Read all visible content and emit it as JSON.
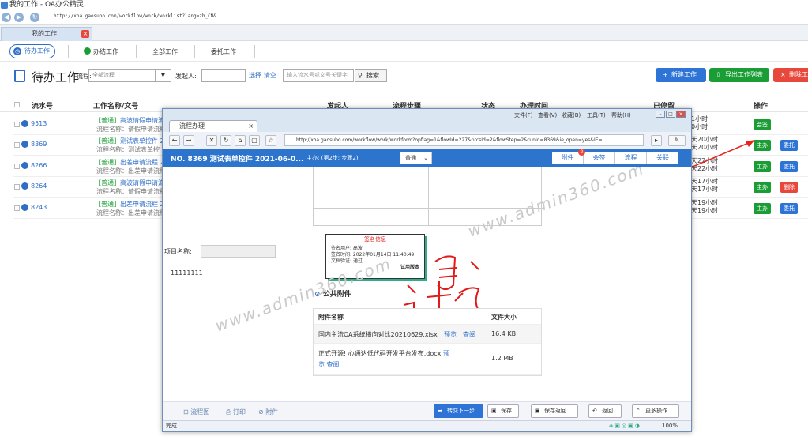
{
  "window": {
    "title": "我的工作 - OA办公精灵",
    "url": "http://xoa.gaosubo.com/workflow/work/worklist?lang=zh_CN&"
  },
  "tabs": [
    {
      "label": "我的工作"
    }
  ],
  "subnav": {
    "items": [
      "待办工作",
      "办结工作",
      "全部工作",
      "委托工作"
    ]
  },
  "toolbar": {
    "title": "待办工作",
    "flow_label": "流程:",
    "flow_select": "全部流程",
    "initiator_label": "发起人:",
    "select_link": "选择",
    "clear_link": "清空",
    "search_placeholder": "输入流水号或文号关键字",
    "search_btn": "搜索",
    "new_btn": "新建工作",
    "export_btn": "导出工作列表",
    "delete_btn": "删除工"
  },
  "table": {
    "headers": [
      "流水号",
      "工作名称/文号",
      "发起人",
      "流程步骤",
      "状态",
      "办理时间",
      "已停留",
      "操作"
    ],
    "rows": [
      {
        "no": "9513",
        "tag": "【普通】",
        "title": "高波请假申请流程",
        "flow": "流程名称：请假申请流程",
        "time1": "1小时",
        "time2": "0小时",
        "btns": [
          "会签"
        ]
      },
      {
        "no": "8369",
        "tag": "【普通】",
        "title": "测试表单控件 20",
        "flow": "流程名称：测试表单控",
        "time1": "天20小时",
        "time2": "天20小时",
        "btns": [
          "主办",
          "委托"
        ]
      },
      {
        "no": "8266",
        "tag": "【普通】",
        "title": "出差申请流程 20",
        "flow": "流程名称：出差申请流程",
        "time1": "天22小时",
        "time2": "天22小时",
        "btns": [
          "主办",
          "委托"
        ]
      },
      {
        "no": "8264",
        "tag": "【普通】",
        "title": "高波请假申请流程",
        "flow": "流程名称：请假申请流程",
        "time1": "天17小时",
        "time2": "天17小时",
        "btns": [
          "主办",
          "删除"
        ]
      },
      {
        "no": "8243",
        "tag": "【普通】",
        "title": "出差申请流程 20",
        "flow": "流程名称：出差申请流程",
        "time1": "天19小时",
        "time2": "天19小时",
        "btns": [
          "主办",
          "委托"
        ]
      }
    ]
  },
  "popup": {
    "tab_title": "流程办理",
    "menu": [
      "文件(F)",
      "查看(V)",
      "收藏(B)",
      "工具(T)",
      "帮助(H)"
    ],
    "url": "http://xoa.gaosubo.com/workflow/work/workform?opflag=1&flowId=227&prcsId=2&flowStep=2&runId=8369&ie_open=yes&IE=",
    "heading": "NO. 8369 测试表单控件 2021-06-0...",
    "step": "主办: (第2步: 步骤2)",
    "level": "普通",
    "htabs": [
      "附件",
      "会签",
      "流程",
      "关联"
    ],
    "badge": "2",
    "project_label": "项目名称:",
    "project_value": "11111111",
    "signature": {
      "title": "签名信息",
      "user": "签名用户: 高波",
      "time": "签名时间: 2022年01月14日 11:40:49",
      "verify": "文档验证: 通过",
      "trial": "试用版本"
    },
    "handwriting": "试用",
    "attach_title": "公共附件",
    "attach_headers": [
      "附件名称",
      "文件大小"
    ],
    "attachments": [
      {
        "name": "国内主流OA系统横向对比20210629.xlsx",
        "preview": "预览",
        "view": "查阅",
        "size": "16.4 KB"
      },
      {
        "name": "正式开源! 心通达低代码开发平台发布.docx",
        "preview": "预览",
        "view": "查阅",
        "size": "1.2 MB"
      }
    ],
    "footer_links": [
      "流程图",
      "打印",
      "附件"
    ],
    "footer_btns": [
      "转交下一步",
      "保存",
      "保存返回",
      "返回",
      "更多操作"
    ],
    "status": "完成",
    "zoom": "100%"
  },
  "watermark": "www.admin360.com",
  "colors": {
    "primary": "#2e6ec7",
    "green": "#1a9d35",
    "red": "#e8473b"
  }
}
